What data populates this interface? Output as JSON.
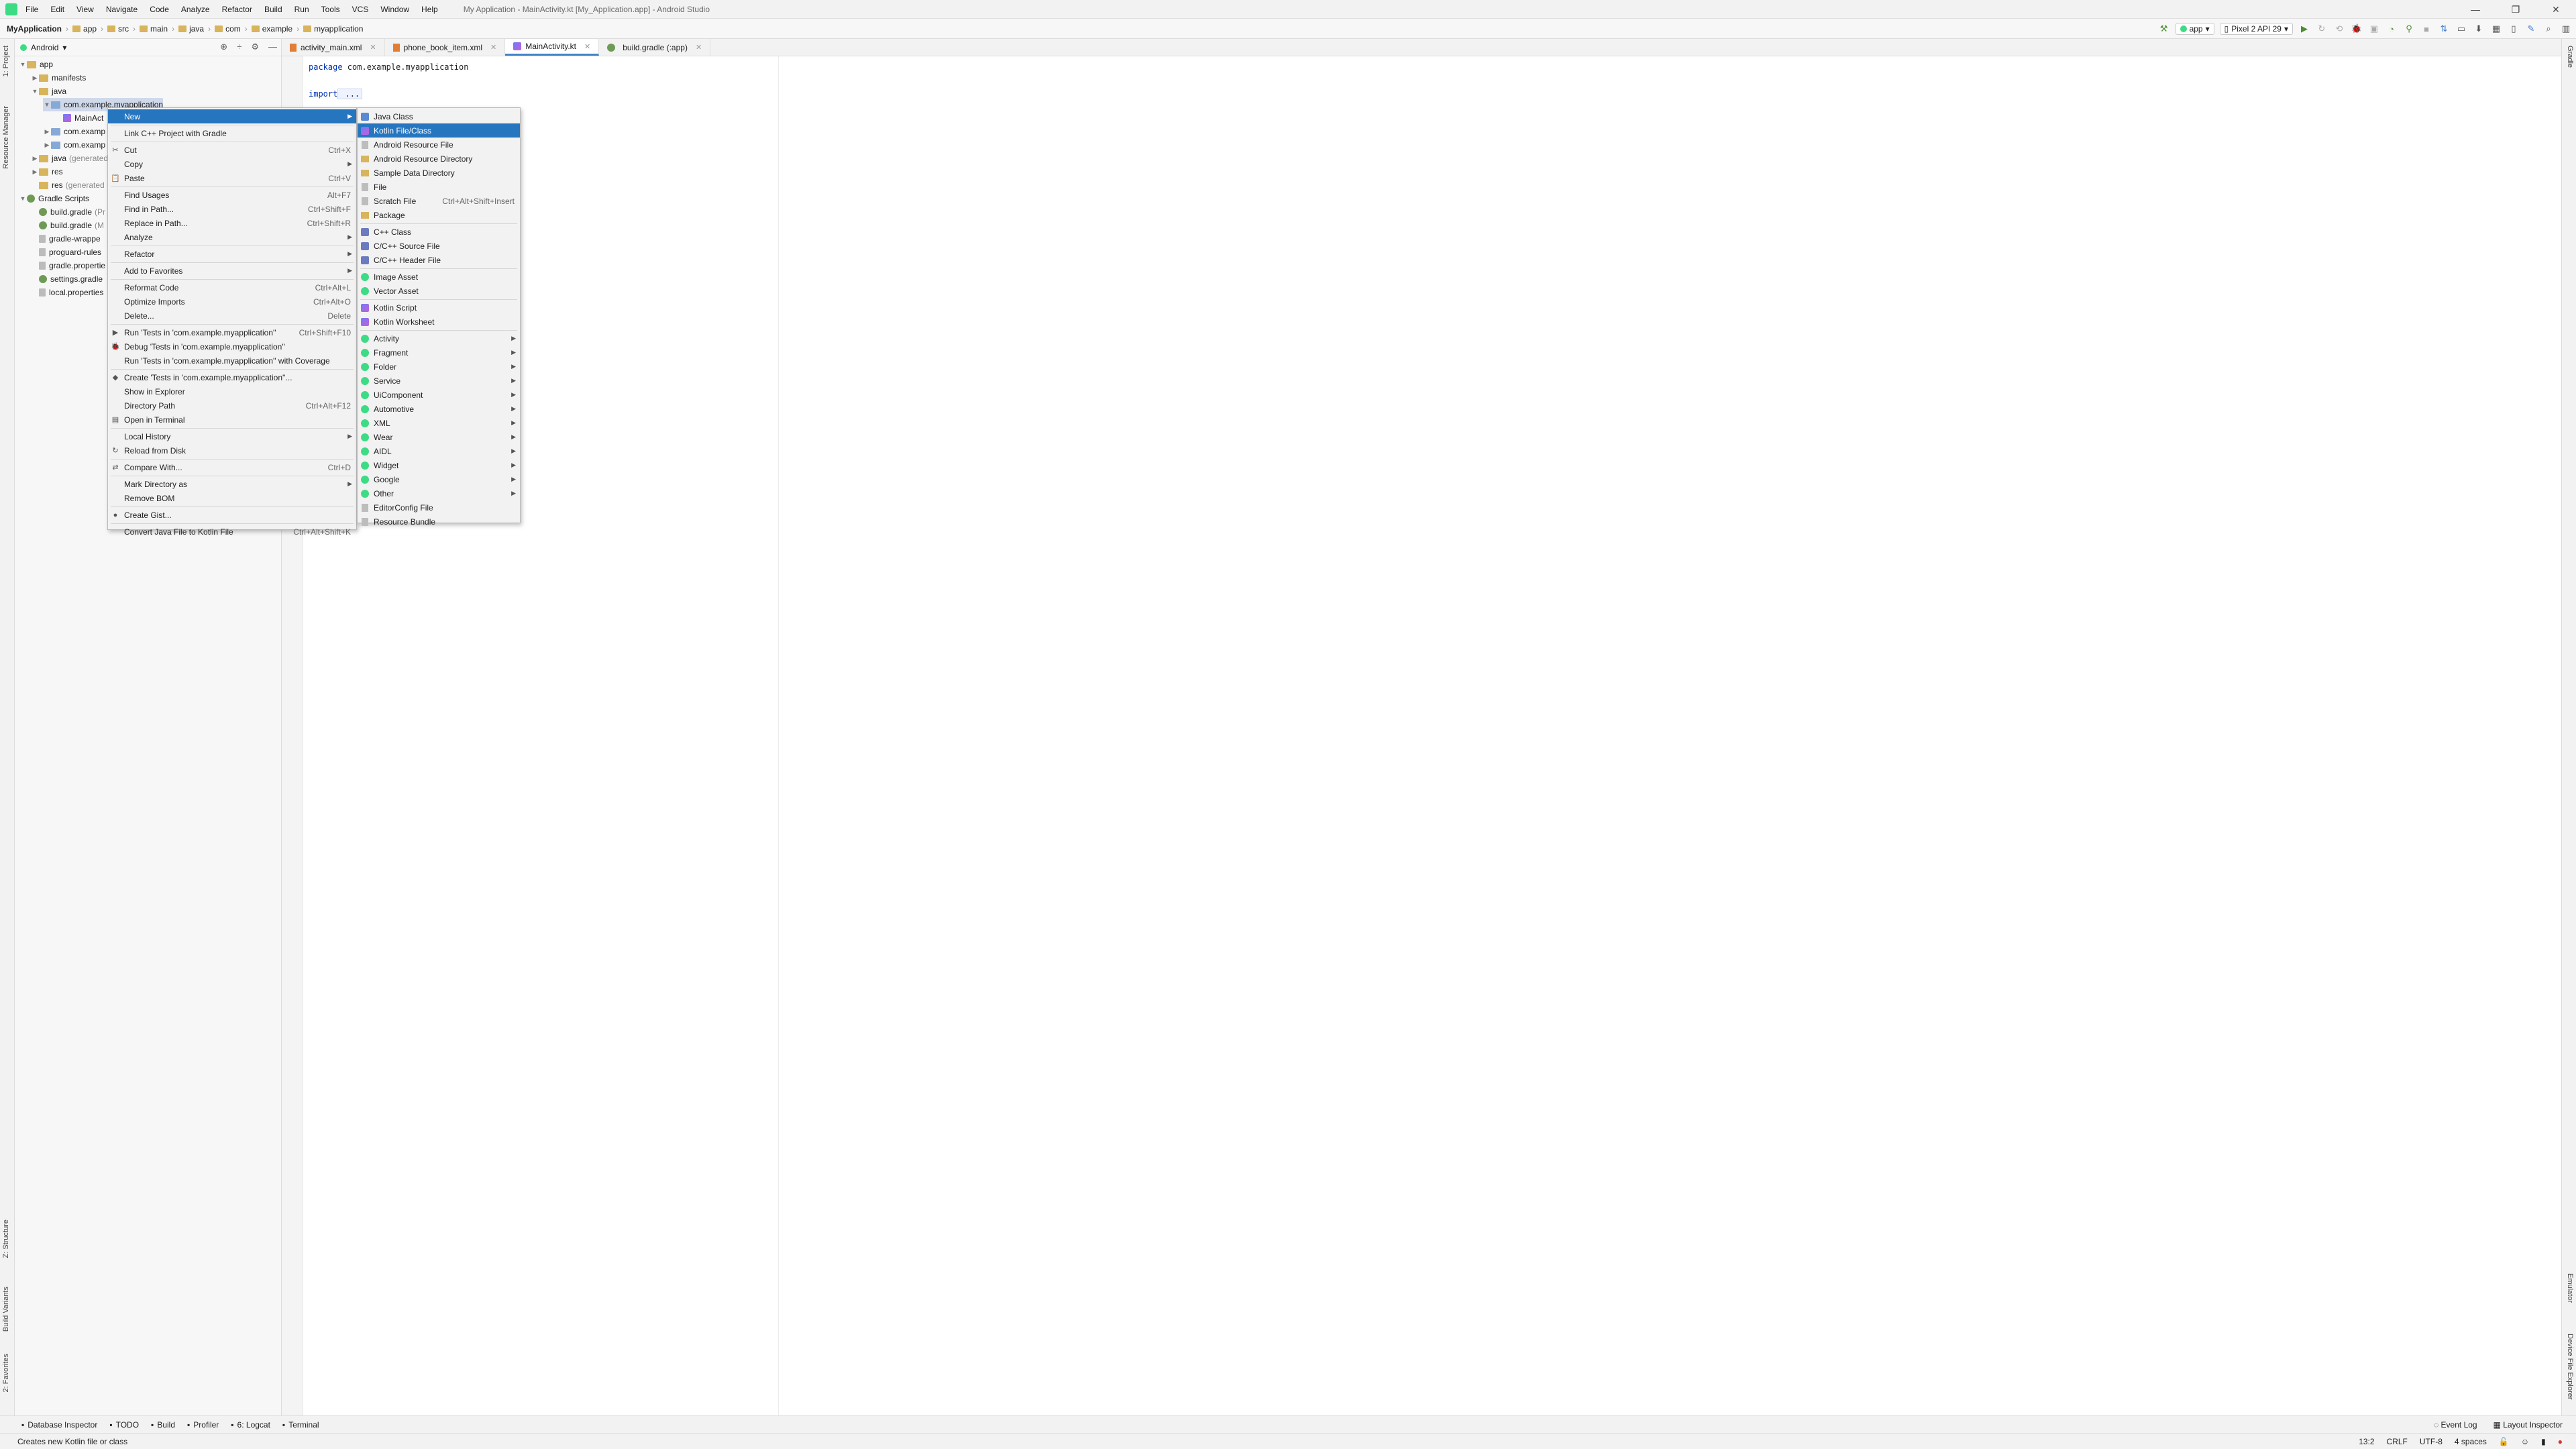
{
  "titlebar": {
    "menu": [
      "File",
      "Edit",
      "View",
      "Navigate",
      "Code",
      "Analyze",
      "Refactor",
      "Build",
      "Run",
      "Tools",
      "VCS",
      "Window",
      "Help"
    ],
    "title": "My Application - MainActivity.kt [My_Application.app] - Android Studio",
    "controls": [
      "—",
      "❐",
      "✕"
    ]
  },
  "navbar": {
    "crumbs": [
      "MyApplication",
      "app",
      "src",
      "main",
      "java",
      "com",
      "example",
      "myapplication"
    ],
    "run_config": "app",
    "device": "Pixel 2 API 29"
  },
  "project": {
    "view": "Android",
    "tree": [
      {
        "label": "app",
        "muted": "",
        "indent": 0,
        "tri": "▼",
        "icon": "f-folder"
      },
      {
        "label": "manifests",
        "muted": "",
        "indent": 1,
        "tri": "▶",
        "icon": "f-folder"
      },
      {
        "label": "java",
        "muted": "",
        "indent": 1,
        "tri": "▼",
        "icon": "f-folder"
      },
      {
        "label": "com.example.myapplication",
        "muted": "",
        "indent": 2,
        "tri": "▼",
        "icon": "f-blue"
      },
      {
        "label": "MainAct",
        "muted": "",
        "indent": 3,
        "tri": "",
        "icon": "f-kt"
      },
      {
        "label": "com.examp",
        "muted": "",
        "indent": 2,
        "tri": "▶",
        "icon": "f-blue"
      },
      {
        "label": "com.examp",
        "muted": "",
        "indent": 2,
        "tri": "▶",
        "icon": "f-blue"
      },
      {
        "label": "java",
        "muted": "(generated",
        "indent": 1,
        "tri": "▶",
        "icon": "f-folder"
      },
      {
        "label": "res",
        "muted": "",
        "indent": 1,
        "tri": "▶",
        "icon": "f-folder"
      },
      {
        "label": "res",
        "muted": "(generated",
        "indent": 1,
        "tri": "",
        "icon": "f-folder"
      },
      {
        "label": "Gradle Scripts",
        "muted": "",
        "indent": 0,
        "tri": "▼",
        "icon": "f-gradle"
      },
      {
        "label": "build.gradle",
        "muted": "(Pr",
        "indent": 1,
        "tri": "",
        "icon": "f-gradle"
      },
      {
        "label": "build.gradle",
        "muted": "(M",
        "indent": 1,
        "tri": "",
        "icon": "f-gradle"
      },
      {
        "label": "gradle-wrappe",
        "muted": "",
        "indent": 1,
        "tri": "",
        "icon": "f-file"
      },
      {
        "label": "proguard-rules",
        "muted": "",
        "indent": 1,
        "tri": "",
        "icon": "f-file"
      },
      {
        "label": "gradle.propertie",
        "muted": "",
        "indent": 1,
        "tri": "",
        "icon": "f-file"
      },
      {
        "label": "settings.gradle",
        "muted": "",
        "indent": 1,
        "tri": "",
        "icon": "f-gradle"
      },
      {
        "label": "local.properties",
        "muted": "",
        "indent": 1,
        "tri": "",
        "icon": "f-file"
      }
    ]
  },
  "editor": {
    "tabs": [
      {
        "label": "activity_main.xml",
        "icon": "xml",
        "active": false
      },
      {
        "label": "phone_book_item.xml",
        "icon": "xml",
        "active": false
      },
      {
        "label": "MainActivity.kt",
        "icon": "kt",
        "active": true
      },
      {
        "label": "build.gradle (:app)",
        "icon": "gradle",
        "active": false
      }
    ],
    "lines": [
      {
        "kw": "package",
        "text": " com.example.myapplication"
      },
      {
        "kw": "",
        "text": ""
      },
      {
        "kw": "import",
        "text": " ..."
      },
      {
        "kw": "",
        "text": ""
      },
      {
        "kw": "",
        "text": ""
      },
      {
        "kw": "",
        "text": "                                Bundle?) {"
      },
      {
        "kw": "",
        "text": ""
      },
      {
        "kw": "",
        "text": ""
      },
      {
        "kw": "",
        "text": "                                )"
      }
    ]
  },
  "context_menu": [
    {
      "label": "New",
      "shortcut": "",
      "submenu": true,
      "highlight": true,
      "icon": ""
    },
    {
      "sep": true
    },
    {
      "label": "Link C++ Project with Gradle",
      "shortcut": "",
      "icon": ""
    },
    {
      "sep": true
    },
    {
      "label": "Cut",
      "shortcut": "Ctrl+X",
      "icon": "✂"
    },
    {
      "label": "Copy",
      "shortcut": "",
      "submenu": true,
      "icon": ""
    },
    {
      "label": "Paste",
      "shortcut": "Ctrl+V",
      "icon": "📋"
    },
    {
      "sep": true
    },
    {
      "label": "Find Usages",
      "shortcut": "Alt+F7",
      "icon": ""
    },
    {
      "label": "Find in Path...",
      "shortcut": "Ctrl+Shift+F",
      "icon": ""
    },
    {
      "label": "Replace in Path...",
      "shortcut": "Ctrl+Shift+R",
      "icon": ""
    },
    {
      "label": "Analyze",
      "shortcut": "",
      "submenu": true,
      "icon": ""
    },
    {
      "sep": true
    },
    {
      "label": "Refactor",
      "shortcut": "",
      "submenu": true,
      "icon": ""
    },
    {
      "sep": true
    },
    {
      "label": "Add to Favorites",
      "shortcut": "",
      "submenu": true,
      "icon": ""
    },
    {
      "sep": true
    },
    {
      "label": "Reformat Code",
      "shortcut": "Ctrl+Alt+L",
      "icon": ""
    },
    {
      "label": "Optimize Imports",
      "shortcut": "Ctrl+Alt+O",
      "icon": ""
    },
    {
      "label": "Delete...",
      "shortcut": "Delete",
      "icon": ""
    },
    {
      "sep": true
    },
    {
      "label": "Run 'Tests in 'com.example.myapplication''",
      "shortcut": "Ctrl+Shift+F10",
      "icon": "▶"
    },
    {
      "label": "Debug 'Tests in 'com.example.myapplication''",
      "shortcut": "",
      "icon": "🐞"
    },
    {
      "label": "Run 'Tests in 'com.example.myapplication'' with Coverage",
      "shortcut": "",
      "icon": ""
    },
    {
      "sep": true
    },
    {
      "label": "Create 'Tests in 'com.example.myapplication''...",
      "shortcut": "",
      "icon": "◆"
    },
    {
      "label": "Show in Explorer",
      "shortcut": "",
      "icon": ""
    },
    {
      "label": "Directory Path",
      "shortcut": "Ctrl+Alt+F12",
      "icon": ""
    },
    {
      "label": "Open in Terminal",
      "shortcut": "",
      "icon": "▤"
    },
    {
      "sep": true
    },
    {
      "label": "Local History",
      "shortcut": "",
      "submenu": true,
      "icon": ""
    },
    {
      "label": "Reload from Disk",
      "shortcut": "",
      "icon": "↻"
    },
    {
      "sep": true
    },
    {
      "label": "Compare With...",
      "shortcut": "Ctrl+D",
      "icon": "⇄"
    },
    {
      "sep": true
    },
    {
      "label": "Mark Directory as",
      "shortcut": "",
      "submenu": true,
      "icon": ""
    },
    {
      "label": "Remove BOM",
      "shortcut": "",
      "icon": ""
    },
    {
      "sep": true
    },
    {
      "label": "Create Gist...",
      "shortcut": "",
      "icon": "●"
    },
    {
      "sep": true
    },
    {
      "label": "Convert Java File to Kotlin File",
      "shortcut": "Ctrl+Alt+Shift+K",
      "icon": ""
    }
  ],
  "new_submenu": [
    {
      "label": "Java Class",
      "shortcut": "",
      "icon": "sq-blue"
    },
    {
      "label": "Kotlin File/Class",
      "shortcut": "",
      "icon": "sq-kt",
      "highlight": true
    },
    {
      "label": "Android Resource File",
      "shortcut": "",
      "icon": "sq-f"
    },
    {
      "label": "Android Resource Directory",
      "shortcut": "",
      "icon": "sq-y"
    },
    {
      "label": "Sample Data Directory",
      "shortcut": "",
      "icon": "sq-y"
    },
    {
      "label": "File",
      "shortcut": "",
      "icon": "sq-f"
    },
    {
      "label": "Scratch File",
      "shortcut": "Ctrl+Alt+Shift+Insert",
      "icon": "sq-f"
    },
    {
      "label": "Package",
      "shortcut": "",
      "icon": "sq-y"
    },
    {
      "sep": true
    },
    {
      "label": "C++ Class",
      "shortcut": "",
      "icon": "sq-c"
    },
    {
      "label": "C/C++ Source File",
      "shortcut": "",
      "icon": "sq-c"
    },
    {
      "label": "C/C++ Header File",
      "shortcut": "",
      "icon": "sq-c"
    },
    {
      "sep": true
    },
    {
      "label": "Image Asset",
      "shortcut": "",
      "icon": "dot-green"
    },
    {
      "label": "Vector Asset",
      "shortcut": "",
      "icon": "dot-green"
    },
    {
      "sep": true
    },
    {
      "label": "Kotlin Script",
      "shortcut": "",
      "icon": "sq-kt"
    },
    {
      "label": "Kotlin Worksheet",
      "shortcut": "",
      "icon": "sq-kt"
    },
    {
      "sep": true
    },
    {
      "label": "Activity",
      "shortcut": "",
      "submenu": true,
      "icon": "dot-green"
    },
    {
      "label": "Fragment",
      "shortcut": "",
      "submenu": true,
      "icon": "dot-green"
    },
    {
      "label": "Folder",
      "shortcut": "",
      "submenu": true,
      "icon": "dot-green"
    },
    {
      "label": "Service",
      "shortcut": "",
      "submenu": true,
      "icon": "dot-green"
    },
    {
      "label": "UiComponent",
      "shortcut": "",
      "submenu": true,
      "icon": "dot-green"
    },
    {
      "label": "Automotive",
      "shortcut": "",
      "submenu": true,
      "icon": "dot-green"
    },
    {
      "label": "XML",
      "shortcut": "",
      "submenu": true,
      "icon": "dot-green"
    },
    {
      "label": "Wear",
      "shortcut": "",
      "submenu": true,
      "icon": "dot-green"
    },
    {
      "label": "AIDL",
      "shortcut": "",
      "submenu": true,
      "icon": "dot-green"
    },
    {
      "label": "Widget",
      "shortcut": "",
      "submenu": true,
      "icon": "dot-green"
    },
    {
      "label": "Google",
      "shortcut": "",
      "submenu": true,
      "icon": "dot-green"
    },
    {
      "label": "Other",
      "shortcut": "",
      "submenu": true,
      "icon": "dot-green"
    },
    {
      "label": "EditorConfig File",
      "shortcut": "",
      "icon": "sq-f"
    },
    {
      "label": "Resource Bundle",
      "shortcut": "",
      "icon": "sq-f"
    }
  ],
  "left_tabs": [
    "1: Project",
    "Resource Manager",
    "Z: Structure",
    "Build Variants",
    "2: Favorites"
  ],
  "right_tabs": [
    "Gradle",
    "Emulator",
    "Device File Explorer"
  ],
  "bottom_tabs": [
    "Database Inspector",
    "TODO",
    "Build",
    "Profiler",
    "6: Logcat",
    "Terminal"
  ],
  "bottom_right": [
    "Event Log",
    "Layout Inspector"
  ],
  "status": {
    "message": "Creates new Kotlin file or class",
    "position": "13:2",
    "line_sep": "CRLF",
    "encoding": "UTF-8",
    "indent": "4 spaces"
  },
  "colors": {
    "accent": "#2675bf",
    "android": "#3ddc84"
  }
}
